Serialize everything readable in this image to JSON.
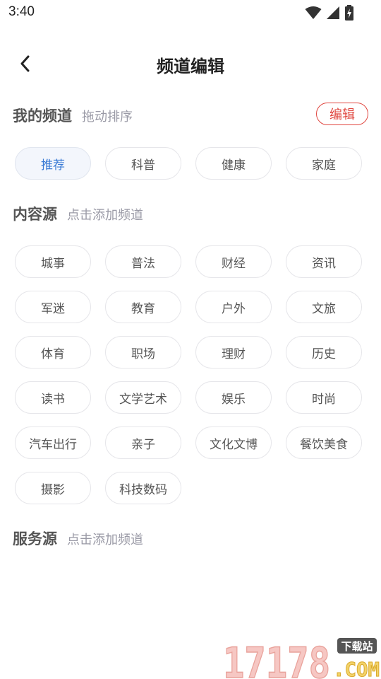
{
  "status": {
    "time": "3:40"
  },
  "header": {
    "title": "频道编辑"
  },
  "my_channels": {
    "title": "我的频道",
    "hint": "拖动排序",
    "edit_label": "编辑",
    "items": [
      {
        "label": "推荐",
        "active": true
      },
      {
        "label": "科普"
      },
      {
        "label": "健康"
      },
      {
        "label": "家庭"
      }
    ]
  },
  "content_sources": {
    "title": "内容源",
    "hint": "点击添加频道",
    "items": [
      {
        "label": "城事"
      },
      {
        "label": "普法"
      },
      {
        "label": "财经"
      },
      {
        "label": "资讯"
      },
      {
        "label": "军迷"
      },
      {
        "label": "教育"
      },
      {
        "label": "户外"
      },
      {
        "label": "文旅"
      },
      {
        "label": "体育"
      },
      {
        "label": "职场"
      },
      {
        "label": "理财"
      },
      {
        "label": "历史"
      },
      {
        "label": "读书"
      },
      {
        "label": "文学艺术"
      },
      {
        "label": "娱乐"
      },
      {
        "label": "时尚"
      },
      {
        "label": "汽车出行"
      },
      {
        "label": "亲子"
      },
      {
        "label": "文化文博"
      },
      {
        "label": "餐饮美食"
      },
      {
        "label": "摄影"
      },
      {
        "label": "科技数码"
      }
    ]
  },
  "service_sources": {
    "title": "服务源",
    "hint": "点击添加频道"
  },
  "watermark": {
    "number": "17178",
    "badge": "下载站",
    "domain": ".COM"
  },
  "icons": {
    "back": "chevron-left-icon",
    "wifi": "wifi-icon",
    "signal": "signal-icon",
    "battery": "battery-charging-icon"
  },
  "colors": {
    "accent_red": "#e0463f",
    "active_blue": "#3a7bd5",
    "active_bg": "#f3f6fc",
    "chip_border": "#e6e6ea",
    "hint_gray": "#9a9aa6"
  }
}
